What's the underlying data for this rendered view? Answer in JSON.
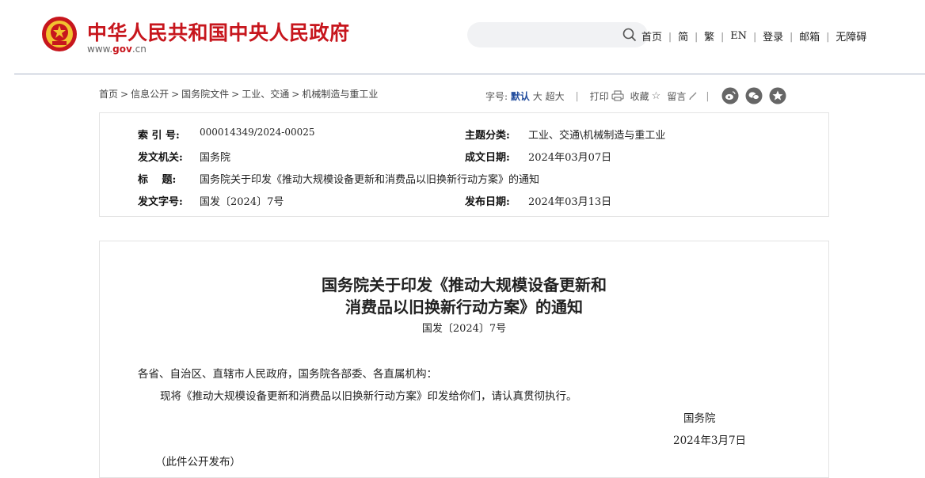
{
  "header": {
    "site_title": "中华人民共和国中央人民政府",
    "domain_prefix": "www.",
    "domain_gov": "gov",
    "domain_suffix": ".cn",
    "nav": [
      "首页",
      "简",
      "繁",
      "EN",
      "登录",
      "邮箱",
      "无障碍"
    ],
    "search_placeholder": ""
  },
  "breadcrumb": [
    "首页",
    "信息公开",
    "国务院文件",
    "工业、交通",
    "机械制造与重工业"
  ],
  "toolbar": {
    "font_size_label": "字号:",
    "font_default": "默认",
    "font_large": "大",
    "font_xlarge": "超大",
    "print": "打印",
    "favorite": "收藏",
    "comment": "留言"
  },
  "info": {
    "index_label": "索 引 号:",
    "index_value": "000014349/2024-00025",
    "topic_label": "主题分类:",
    "topic_value": "工业、交通\\机械制造与重工业",
    "issuer_label": "发文机关:",
    "issuer_value": "国务院",
    "written_label": "成文日期:",
    "written_value": "2024年03月07日",
    "title_label": "标　 题:",
    "title_value": "国务院关于印发《推动大规模设备更新和消费品以旧换新行动方案》的通知",
    "docno_label": "发文字号:",
    "docno_value": "国发〔2024〕7号",
    "publish_label": "发布日期:",
    "publish_value": "2024年03月13日"
  },
  "document": {
    "title_line1": "国务院关于印发《推动大规模设备更新和",
    "title_line2": "消费品以旧换新行动方案》的通知",
    "number": "国发〔2024〕7号",
    "salutation": "各省、自治区、直辖市人民政府，国务院各部委、各直属机构：",
    "body": "现将《推动大规模设备更新和消费品以旧换新行动方案》印发给你们，请认真贯彻执行。",
    "signer": "国务院",
    "date": "2024年3月7日",
    "note": "（此件公开发布）"
  },
  "colors": {
    "brand_red": "#c7161d",
    "link_blue": "#1f4a9c"
  }
}
